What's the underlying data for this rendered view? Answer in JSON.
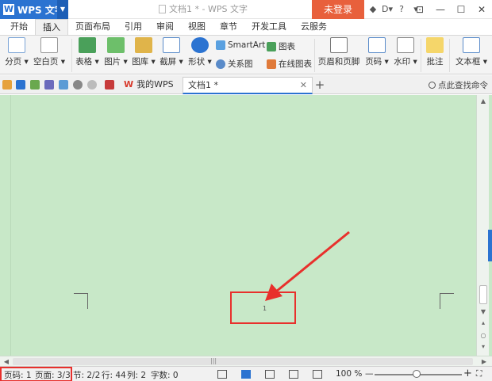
{
  "title_bar": {
    "app_name": "WPS 文字",
    "doc_title": "文档1 * - WPS 文字",
    "login": "未登录",
    "help": "?"
  },
  "ribbon_tabs": [
    "开始",
    "插入",
    "页面布局",
    "引用",
    "审阅",
    "视图",
    "章节",
    "开发工具",
    "云服务"
  ],
  "active_tab": "插入",
  "ribbon": {
    "page_break": "分页",
    "blank_page": "空白页",
    "table": "表格",
    "picture": "图片",
    "gallery": "图库",
    "screenshot": "截屏",
    "shape": "形状",
    "smartart": "SmartArt",
    "chart": "图表",
    "relation": "关系图",
    "online_chart": "在线图表",
    "header_footer": "页眉和页脚",
    "page_number": "页码",
    "watermark": "水印",
    "comment": "批注",
    "textbox": "文本框"
  },
  "doc_tabs": {
    "mywps": "我的WPS",
    "doc": "文档1 *",
    "search_cmd": "点此查找命令"
  },
  "document": {
    "page_number_text": "1"
  },
  "status_bar": {
    "page_code": "页码: 1",
    "page": "页面: 3/3",
    "section": "节: 2/2",
    "row": "行: 44",
    "col": "列: 2",
    "words": "字数: 0",
    "zoom": "100 %"
  },
  "colors": {
    "brand": "#2b73d1",
    "login": "#e8603c",
    "page_bg": "#c8e8c8",
    "annotation": "#e8302c"
  }
}
